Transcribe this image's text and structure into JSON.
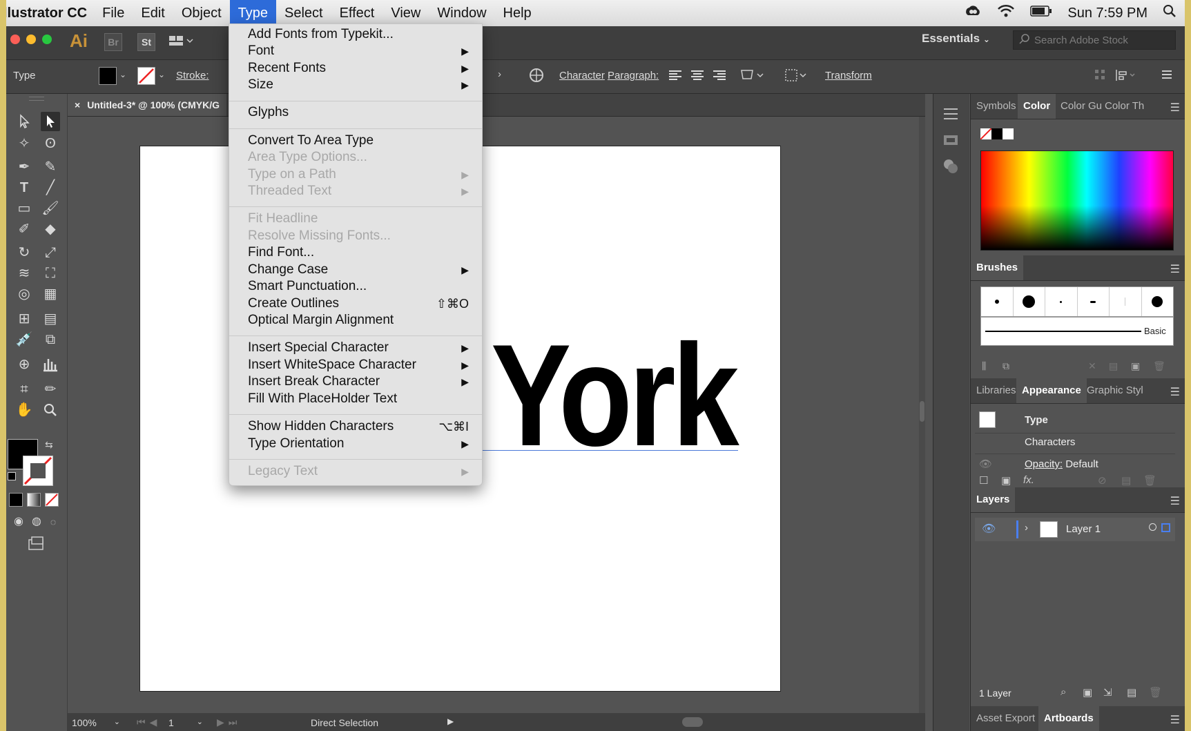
{
  "menubar": {
    "app_name": "llustrator CC",
    "items": [
      "File",
      "Edit",
      "Object",
      "Type",
      "Select",
      "Effect",
      "View",
      "Window",
      "Help"
    ],
    "active": "Type",
    "time": "Sun 7:59 PM"
  },
  "appbar": {
    "logo": "Ai",
    "bridge": "Br",
    "stock": "St",
    "workspace": "Essentials",
    "search_placeholder": "Search Adobe Stock"
  },
  "control": {
    "tool_label": "Type",
    "stroke_label": "Stroke:",
    "character": "Character",
    "paragraph": "Paragraph:",
    "transform": "Transform"
  },
  "document": {
    "tab_title": "Untitled-3* @ 100% (CMYK/G",
    "artwork_text": "York"
  },
  "type_menu": {
    "items": [
      {
        "label": "Add Fonts from Typekit...",
        "enabled": true
      },
      {
        "label": "Font",
        "enabled": true,
        "submenu": true
      },
      {
        "label": "Recent Fonts",
        "enabled": true,
        "submenu": true
      },
      {
        "label": "Size",
        "enabled": true,
        "submenu": true
      },
      {
        "label": "Glyphs",
        "enabled": true
      },
      {
        "label": "Convert To Area Type",
        "enabled": true
      },
      {
        "label": "Area Type Options...",
        "enabled": false
      },
      {
        "label": "Type on a Path",
        "enabled": false,
        "submenu": true
      },
      {
        "label": "Threaded Text",
        "enabled": false,
        "submenu": true
      },
      {
        "label": "Fit Headline",
        "enabled": false
      },
      {
        "label": "Resolve Missing Fonts...",
        "enabled": false
      },
      {
        "label": "Find Font...",
        "enabled": true
      },
      {
        "label": "Change Case",
        "enabled": true,
        "submenu": true
      },
      {
        "label": "Smart Punctuation...",
        "enabled": true
      },
      {
        "label": "Create Outlines",
        "enabled": true,
        "shortcut": "⇧⌘O"
      },
      {
        "label": "Optical Margin Alignment",
        "enabled": true
      },
      {
        "label": "Insert Special Character",
        "enabled": true,
        "submenu": true
      },
      {
        "label": "Insert WhiteSpace Character",
        "enabled": true,
        "submenu": true
      },
      {
        "label": "Insert Break Character",
        "enabled": true,
        "submenu": true
      },
      {
        "label": "Fill With PlaceHolder Text",
        "enabled": true
      },
      {
        "label": "Show Hidden Characters",
        "enabled": true,
        "shortcut": "⌥⌘I"
      },
      {
        "label": "Type Orientation",
        "enabled": true,
        "submenu": true
      },
      {
        "label": "Legacy Text",
        "enabled": false,
        "submenu": true
      }
    ]
  },
  "panels": {
    "color_tabs": [
      "Symbols",
      "Color",
      "Color Gu",
      "Color Th"
    ],
    "brushes_title": "Brushes",
    "brush_basic": "Basic",
    "appearance_tabs": [
      "Libraries",
      "Appearance",
      "Graphic Styl"
    ],
    "appearance_type": "Type",
    "appearance_characters": "Characters",
    "appearance_opacity": "Opacity:",
    "appearance_opacity_value": "Default",
    "layers_title": "Layers",
    "layer_name": "Layer 1",
    "layers_count": "1 Layer",
    "bottom_tabs": [
      "Asset Export",
      "Artboards"
    ]
  },
  "status": {
    "zoom": "100%",
    "artboard_num": "1",
    "tool": "Direct Selection"
  }
}
